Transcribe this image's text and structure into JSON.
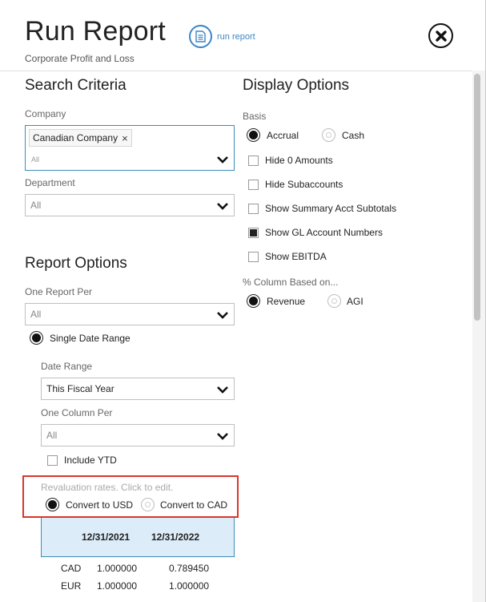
{
  "header": {
    "title": "Run Report",
    "subtitle": "Corporate Profit and Loss",
    "run_label": "run report"
  },
  "search_criteria": {
    "heading": "Search Criteria",
    "company_label": "Company",
    "company_tag": "Canadian Company",
    "company_placeholder": "All",
    "department_label": "Department",
    "department_value": "All"
  },
  "report_options": {
    "heading": "Report Options",
    "one_report_per_label": "One Report Per",
    "one_report_per_value": "All",
    "single_date_range_label": "Single Date Range",
    "date_range_label": "Date Range",
    "date_range_value": "This Fiscal Year",
    "one_column_per_label": "One Column Per",
    "one_column_per_value": "All",
    "include_ytd_label": "Include YTD",
    "revaluation_label": "Revaluation rates. Click to edit.",
    "convert_usd_label": "Convert to USD",
    "convert_cad_label": "Convert to CAD"
  },
  "rates_table": {
    "columns": [
      "12/31/2021",
      "12/31/2022"
    ],
    "rows": [
      {
        "currency": "CAD",
        "values": [
          "1.000000",
          "0.789450"
        ]
      },
      {
        "currency": "EUR",
        "values": [
          "1.000000",
          "1.000000"
        ]
      }
    ]
  },
  "display_options": {
    "heading": "Display Options",
    "basis_label": "Basis",
    "accrual_label": "Accrual",
    "cash_label": "Cash",
    "checkboxes": [
      {
        "label": "Hide 0 Amounts",
        "checked": false
      },
      {
        "label": "Hide Subaccounts",
        "checked": false
      },
      {
        "label": "Show Summary Acct Subtotals",
        "checked": false
      },
      {
        "label": "Show GL Account Numbers",
        "checked": true
      },
      {
        "label": "Show EBITDA",
        "checked": false
      }
    ],
    "pct_column_label": "% Column Based on...",
    "revenue_label": "Revenue",
    "agi_label": "AGI"
  },
  "colors": {
    "accent": "#3b86c6",
    "highlight_border": "#d9362b",
    "table_header_bg": "#dcecf8"
  }
}
